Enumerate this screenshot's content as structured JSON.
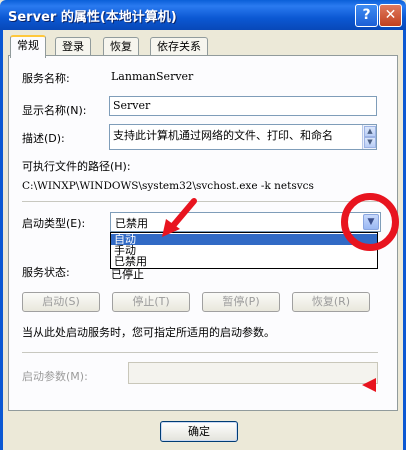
{
  "window": {
    "title": "Server 的属性(本地计算机)",
    "help_label": "?",
    "close_label": "✕"
  },
  "tabs": [
    {
      "label": "常规",
      "active": true
    },
    {
      "label": "登录",
      "active": false
    },
    {
      "label": "恢复",
      "active": false
    },
    {
      "label": "依存关系",
      "active": false
    }
  ],
  "general": {
    "service_name_label": "服务名称:",
    "service_name_value": "LanmanServer",
    "display_name_label": "显示名称(N):",
    "display_name_value": "Server",
    "description_label": "描述(D):",
    "description_value": "支持此计算机通过网络的文件、打印、和命名",
    "path_label": "可执行文件的路径(H):",
    "path_value": "C:\\WINXP\\WINDOWS\\system32\\svchost.exe -k netsvcs",
    "startup_type_label": "启动类型(E):",
    "startup_type_value": "已禁用",
    "startup_options": [
      "自动",
      "手动",
      "已禁用"
    ],
    "startup_selected_index": 0,
    "service_status_label": "服务状态:",
    "service_status_value": "已停止",
    "start_button": "启动(S)",
    "stop_button": "停止(T)",
    "pause_button": "暂停(P)",
    "resume_button": "恢复(R)",
    "hint_text": "当从此处启动服务时，您可指定所适用的启动参数。",
    "start_params_label": "启动参数(M):",
    "start_params_value": ""
  },
  "footer": {
    "ok_button": "确定"
  },
  "colors": {
    "title_bar": "#0b58d3",
    "selection": "#316ac5",
    "annotation": "#e8141f"
  }
}
